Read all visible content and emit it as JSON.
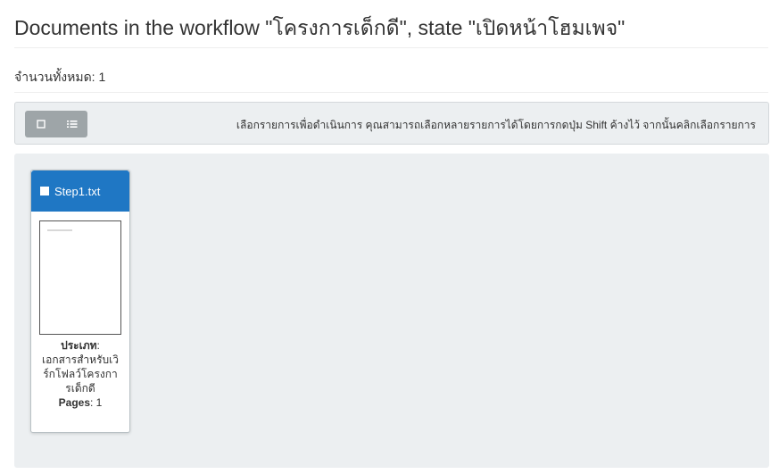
{
  "page": {
    "title": "Documents in the workflow \"โครงการเด็กดี\", state \"เปิดหน้าโฮมเพจ\"",
    "total": "จำนวนทั้งหมด: 1"
  },
  "toolbar": {
    "select_all_icon": "checkbox-icon",
    "list_view_icon": "list-icon",
    "hint": "เลือกรายการเพื่อดำเนินการ คุณสามารถเลือกหลายรายการได้โดยการกดปุ่ม Shift ค้างไว้ จากนั้นคลิกเลือกรายการ"
  },
  "documents": [
    {
      "name": "Step1.txt",
      "type_label": "ประเภท",
      "type_value": "เอกสารสำหรับเวิร์กโฟลว์โครงการเด็กดี",
      "pages_label": "Pages",
      "pages_value": "1"
    }
  ],
  "colors": {
    "card_header": "#1f77c4",
    "toolbar_bg": "#eceff1",
    "button_bg": "#9ea5a8"
  }
}
